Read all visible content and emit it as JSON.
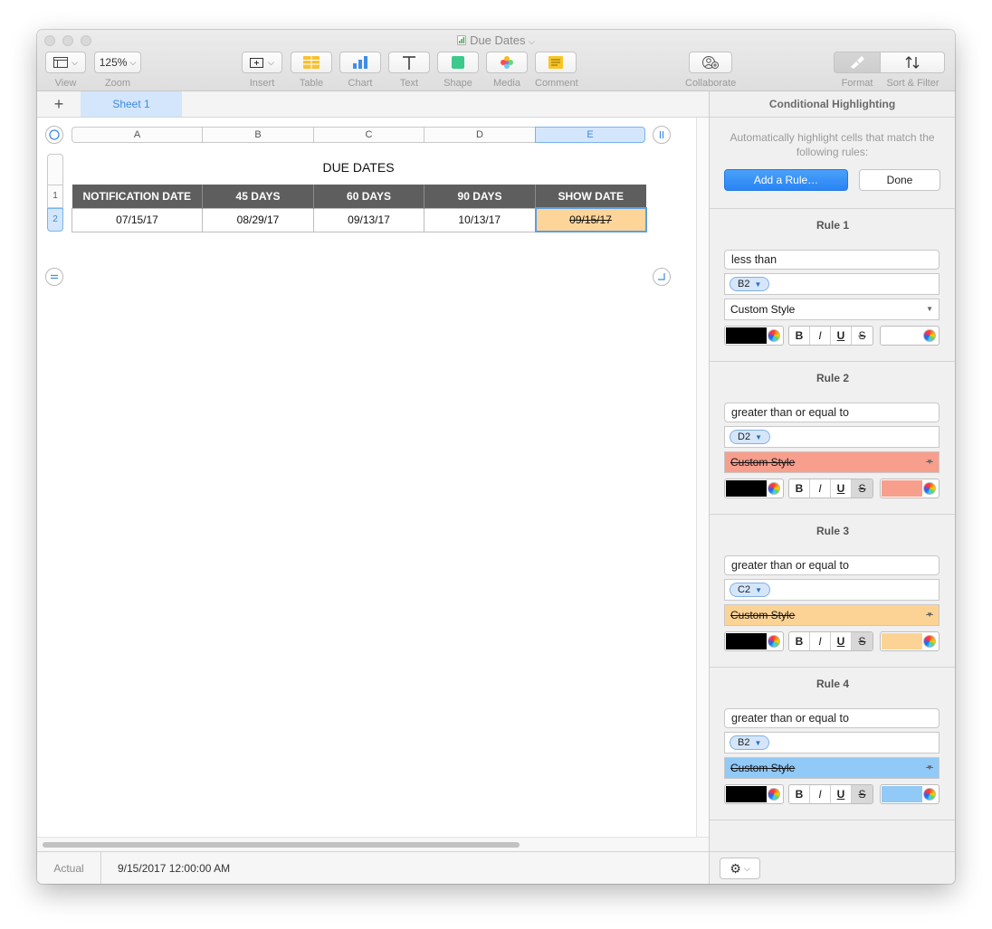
{
  "window": {
    "title": "Due Dates"
  },
  "toolbar": {
    "view_label": "View",
    "zoom_value": "125%",
    "zoom_label": "Zoom",
    "insert_label": "Insert",
    "table_label": "Table",
    "chart_label": "Chart",
    "text_label": "Text",
    "shape_label": "Shape",
    "media_label": "Media",
    "comment_label": "Comment",
    "collaborate_label": "Collaborate",
    "format_label": "Format",
    "sort_filter_label": "Sort & Filter"
  },
  "tabs": {
    "add_label": "+",
    "sheets": [
      {
        "label": "Sheet 1"
      }
    ]
  },
  "spreadsheet": {
    "columns": [
      "A",
      "B",
      "C",
      "D",
      "E"
    ],
    "rows": [
      "1",
      "2"
    ],
    "title": "DUE DATES",
    "header": [
      "NOTIFICATION DATE",
      "45 DAYS",
      "60 DAYS",
      "90 DAYS",
      "SHOW DATE"
    ],
    "data": [
      "07/15/17",
      "08/29/17",
      "09/13/17",
      "10/13/17",
      "09/15/17"
    ]
  },
  "sidebar": {
    "title": "Conditional Highlighting",
    "description": "Automatically highlight cells that match the following rules:",
    "add_rule": "Add a Rule…",
    "done": "Done",
    "rules": [
      {
        "title": "Rule 1",
        "condition": "less than",
        "ref": "B2",
        "style": "Custom Style",
        "fill": "#ffffff"
      },
      {
        "title": "Rule 2",
        "condition": "greater than or equal to",
        "ref": "D2",
        "style": "Custom Style",
        "fill": "#f79e8d"
      },
      {
        "title": "Rule 3",
        "condition": "greater than or equal to",
        "ref": "C2",
        "style": "Custom Style",
        "fill": "#fcd394"
      },
      {
        "title": "Rule 4",
        "condition": "greater than or equal to",
        "ref": "B2",
        "style": "Custom Style",
        "fill": "#91c9f7"
      }
    ],
    "format_buttons": {
      "bold": "B",
      "italic": "I",
      "underline": "U",
      "strike": "S"
    }
  },
  "status": {
    "label": "Actual",
    "value": "9/15/2017 12:00:00 AM"
  },
  "colors": {
    "accent": "#2a84f3",
    "header_fill": "#5e5e5e",
    "selected_cell_fill": "#fdd599"
  }
}
